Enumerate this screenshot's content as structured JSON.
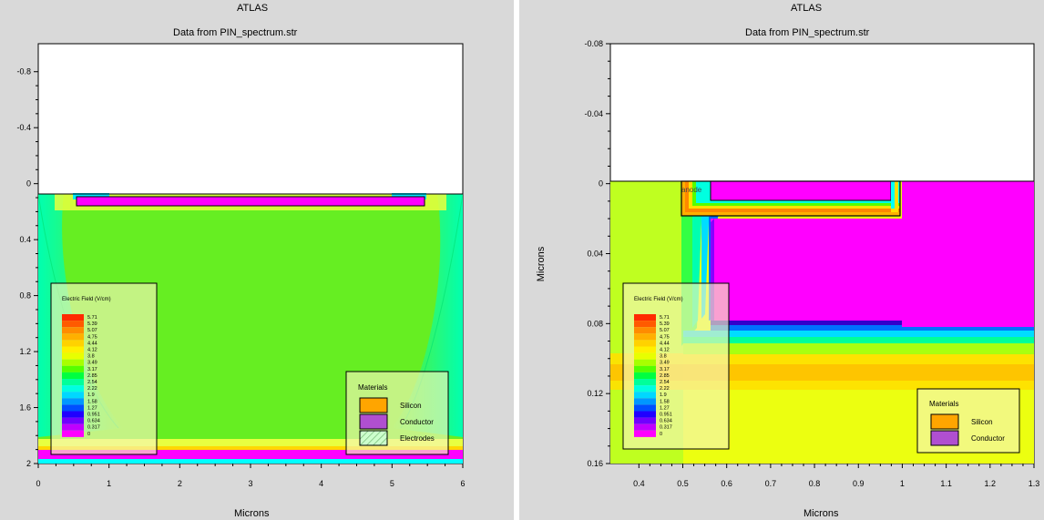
{
  "chart_data": [
    {
      "type": "heatmap",
      "title": "ATLAS",
      "subtitle": "Data from PIN_spectrum.str",
      "xlabel": "Microns",
      "ylabel": "",
      "xlim": [
        0,
        6
      ],
      "ylim": [
        -1.0,
        2.0
      ],
      "y_inverted": true,
      "x_ticks": [
        0,
        1,
        2,
        3,
        4,
        5,
        6
      ],
      "x_tick_labels": [
        "0",
        "1",
        "2",
        "3",
        "4",
        "5",
        "6"
      ],
      "y_ticks": [
        -0.8,
        -0.4,
        0,
        0.4,
        0.8,
        1.2,
        1.6,
        2
      ],
      "y_tick_labels": [
        "-0.8",
        "-0.4",
        "0",
        "0.4",
        "0.8",
        "1.2",
        "1.6",
        "2"
      ],
      "surface_y": 0,
      "device_regions": [
        {
          "material": "Conductor",
          "x": [
            0.55,
            5.5
          ],
          "y": [
            0.0,
            0.09
          ]
        },
        {
          "material": "Conductor",
          "x": [
            0.0,
            6.0
          ],
          "y": [
            1.93,
            2.0
          ]
        }
      ],
      "colorbar": {
        "title": "Electric Field (V/cm)",
        "labels": [
          "5.71",
          "5.39",
          "5.07",
          "4.75",
          "4.44",
          "4.12",
          "3.8",
          "3.49",
          "3.17",
          "2.85",
          "2.54",
          "2.22",
          "1.9",
          "1.58",
          "1.27",
          "0.951",
          "0.634",
          "0.317",
          "0"
        ],
        "colors": [
          "#ff2a00",
          "#ff5a00",
          "#ff8c00",
          "#ffb000",
          "#ffd200",
          "#fff000",
          "#e8ff00",
          "#a8ff00",
          "#55ff00",
          "#00ff40",
          "#00ff9a",
          "#00ffe0",
          "#00d8ff",
          "#0098ff",
          "#0050ff",
          "#2000ff",
          "#7000ff",
          "#c000ff",
          "#ff00ff"
        ]
      },
      "legend": {
        "title": "Materials",
        "placement": "bottom-right",
        "entries": [
          {
            "label": "Silicon",
            "color": "#ffa500"
          },
          {
            "label": "Conductor",
            "color": "#b04fd0"
          },
          {
            "label": "Electrodes",
            "color": "#ccffcc",
            "hatched": true
          }
        ]
      }
    },
    {
      "type": "heatmap",
      "title": "ATLAS",
      "subtitle": "Data from PIN_spectrum.str",
      "xlabel": "Microns",
      "ylabel": "Microns",
      "xlim": [
        0.335,
        1.3
      ],
      "ylim": [
        -0.08,
        0.16
      ],
      "y_inverted": true,
      "x_ticks": [
        0.4,
        0.5,
        0.6,
        0.7,
        0.8,
        0.9,
        1,
        1.1,
        1.2,
        1.3
      ],
      "x_tick_labels": [
        "0.4",
        "0.5",
        "0.6",
        "0.7",
        "0.8",
        "0.9",
        "1",
        "1.1",
        "1.2",
        "1.3"
      ],
      "y_ticks": [
        -0.08,
        -0.04,
        0,
        0.04,
        0.08,
        0.12,
        0.16
      ],
      "y_tick_labels": [
        "-0.08",
        "-0.04",
        "0",
        "0.04",
        "0.08",
        "0.12",
        "0.16"
      ],
      "surface_y": 0,
      "annotation": "anode",
      "device_regions": [
        {
          "material": "Conductor",
          "x": [
            0.5,
            1.0
          ],
          "y": [
            0.0,
            0.02
          ]
        }
      ],
      "colorbar": {
        "title": "Electric Field (V/cm)",
        "labels": [
          "5.71",
          "5.39",
          "5.07",
          "4.75",
          "4.44",
          "4.12",
          "3.8",
          "3.49",
          "3.17",
          "2.85",
          "2.54",
          "2.22",
          "1.9",
          "1.58",
          "1.27",
          "0.951",
          "0.634",
          "0.317",
          "0"
        ],
        "colors": [
          "#ff2a00",
          "#ff5a00",
          "#ff8c00",
          "#ffb000",
          "#ffd200",
          "#fff000",
          "#e8ff00",
          "#a8ff00",
          "#55ff00",
          "#00ff40",
          "#00ff9a",
          "#00ffe0",
          "#00d8ff",
          "#0098ff",
          "#0050ff",
          "#2000ff",
          "#7000ff",
          "#c000ff",
          "#ff00ff"
        ]
      },
      "legend": {
        "title": "Materials",
        "placement": "bottom-right",
        "entries": [
          {
            "label": "Silicon",
            "color": "#ffa500"
          },
          {
            "label": "Conductor",
            "color": "#b04fd0"
          }
        ]
      }
    }
  ]
}
